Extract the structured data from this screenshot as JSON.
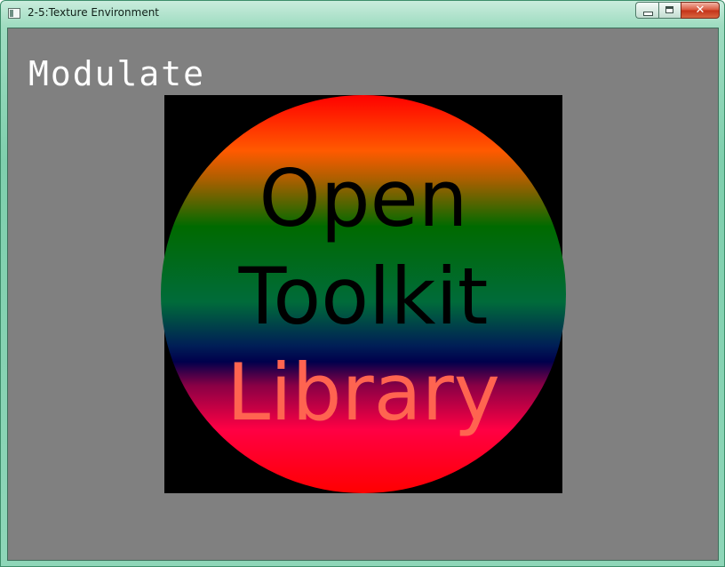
{
  "window": {
    "title": "2-5:Texture Environment",
    "buttons": {
      "minimize_icon": "minimize-icon",
      "maximize_icon": "maximize-icon",
      "close_icon": "close-icon",
      "close_glyph": "✕"
    }
  },
  "scene": {
    "background_color": "#808080",
    "mode_label": "Modulate",
    "texture_lines": [
      "Open",
      "Toolkit",
      "Library"
    ],
    "texture_line_colors": [
      "#000000",
      "#000000",
      "#ff6450"
    ]
  }
}
